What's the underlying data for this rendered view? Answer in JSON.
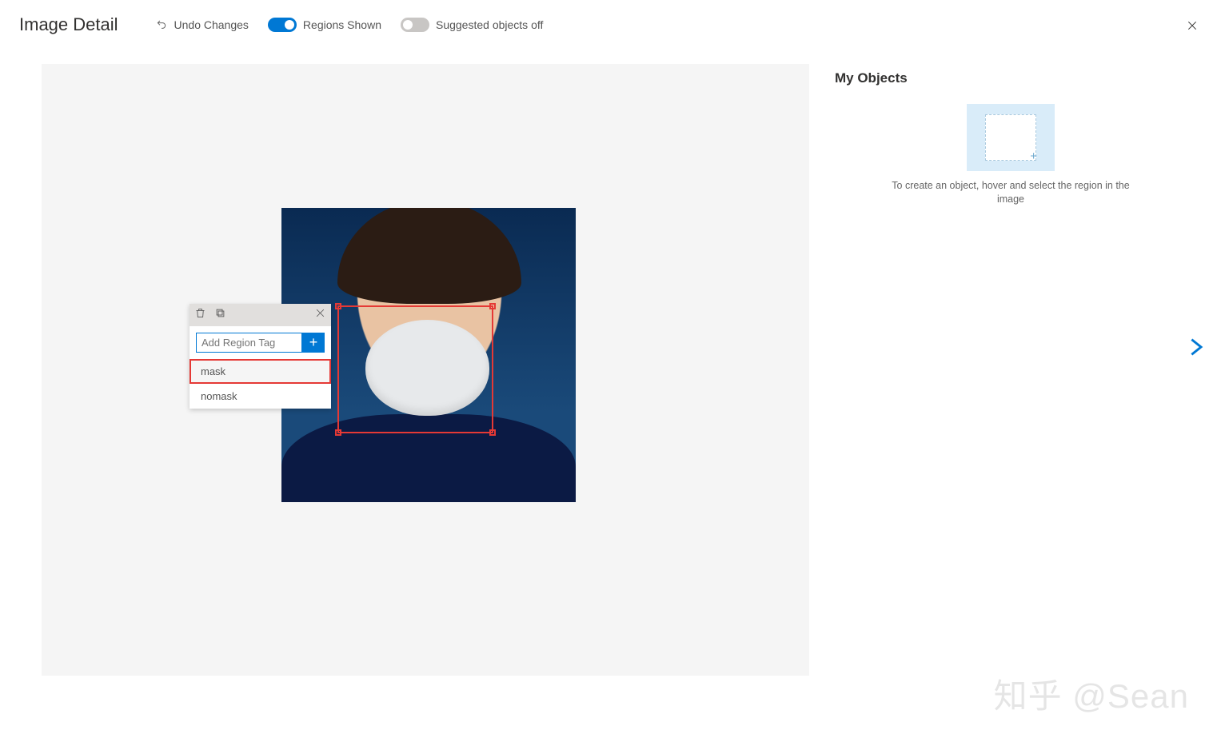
{
  "header": {
    "title": "Image Detail",
    "undo_label": "Undo Changes",
    "regions_label": "Regions Shown",
    "regions_on": true,
    "suggested_label": "Suggested objects off",
    "suggested_on": false
  },
  "region_popup": {
    "input_placeholder": "Add Region Tag",
    "options": [
      {
        "label": "mask",
        "selected": true
      },
      {
        "label": "nomask",
        "selected": false
      }
    ]
  },
  "side_panel": {
    "title": "My Objects",
    "hint": "To create an object, hover and select the region in the image"
  },
  "watermark": "知乎 @Sean",
  "icons": {
    "plus": "+",
    "placeholder_plus": "+"
  }
}
